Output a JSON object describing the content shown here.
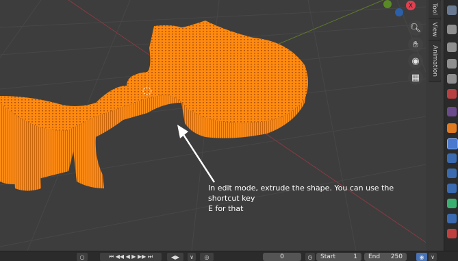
{
  "viewport": {
    "annotation_line1": "In edit mode, extrude the shape. You can use the shortcut key",
    "annotation_line2": "E for that",
    "gizmo": {
      "x_label": "X",
      "y_color": "#6c8f2c",
      "z_color": "#2b5fa8",
      "x_color": "#e04050"
    },
    "nav_icons": [
      "zoom-icon",
      "hand-pan-icon",
      "camera-icon",
      "grid-icon"
    ],
    "shape_color": "#ff8a10"
  },
  "sidebar_tabs": [
    "Tool",
    "View",
    "Animation"
  ],
  "properties_icons": [
    "tool-icon",
    "render-icon",
    "output-icon",
    "view-layer-icon",
    "scene-icon",
    "world-icon",
    "object-icon",
    "modifier-icon",
    "particles-icon",
    "physics-icon",
    "constraints-icon",
    "data-icon",
    "material-icon"
  ],
  "timeline": {
    "current_frame": "0",
    "start_label": "Start",
    "start_value": "1",
    "end_label": "End",
    "end_value": "250"
  }
}
